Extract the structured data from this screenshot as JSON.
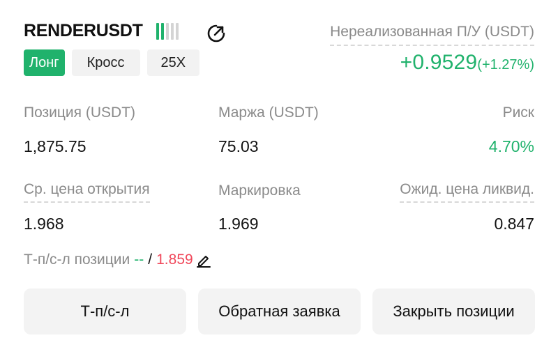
{
  "header": {
    "symbol": "RENDERUSDT",
    "signal_bars": {
      "active": 2,
      "total": 5,
      "active_color": "#20b26c",
      "inactive_color": "#d4d4d4"
    },
    "share_icon": "share-refresh-icon",
    "tags": {
      "side": "Лонг",
      "margin_mode": "Кросс",
      "leverage": "25X"
    }
  },
  "unrealized": {
    "label": "Нереализованная П/У (USDT)",
    "value": "+0.9529",
    "percent": "(+1.27%)"
  },
  "stats": {
    "position_label": "Позиция (USDT)",
    "position_value": "1,875.75",
    "margin_label": "Маржа (USDT)",
    "margin_value": "75.03",
    "risk_label": "Риск",
    "risk_value": "4.70%",
    "avg_open_label": "Ср. цена открытия",
    "avg_open_value": "1.968",
    "mark_label": "Маркировка",
    "mark_value": "1.969",
    "liq_label": "Ожид. цена ликвид.",
    "liq_value": "0.847"
  },
  "tpsl": {
    "label": "Т-п/с-л позиции",
    "tp": "--",
    "separator": "/",
    "sl": "1.859",
    "edit_icon": "edit-pencil-icon"
  },
  "buttons": {
    "tpsl": "Т-п/с-л",
    "reverse": "Обратная заявка",
    "close": "Закрыть позиции"
  },
  "colors": {
    "green": "#20b26c",
    "red": "#f0475a",
    "muted": "#8a8a8a"
  }
}
